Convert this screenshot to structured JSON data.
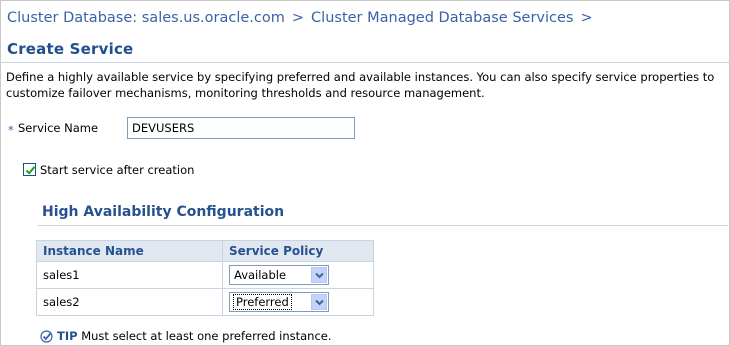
{
  "breadcrumb": {
    "items": [
      "Cluster Database: sales.us.oracle.com",
      "Cluster Managed Database Services"
    ],
    "separator": ">"
  },
  "page_title": "Create Service",
  "description": "Define a highly available service by specifying preferred and available instances. You can also specify service properties to customize failover mechanisms, monitoring thresholds and resource management.",
  "service_name": {
    "required_marker": "*",
    "label": "Service Name",
    "value": "DEVUSERS"
  },
  "start_after_creation": {
    "label": "Start service after creation",
    "checked": true
  },
  "ha_config": {
    "title": "High Availability Configuration",
    "columns": [
      "Instance Name",
      "Service Policy"
    ],
    "rows": [
      {
        "instance": "sales1",
        "policy": "Available"
      },
      {
        "instance": "sales2",
        "policy": "Preferred"
      }
    ]
  },
  "tip": {
    "label": "TIP",
    "text": "Must select at least one preferred instance."
  },
  "colors": {
    "link": "#3a62a8",
    "heading": "#26528f",
    "header_bg": "#e1e8f2"
  },
  "icons": {
    "checkbox": "checkmark-icon",
    "dropdown": "chevron-down-icon",
    "tip": "tip-check-icon"
  }
}
